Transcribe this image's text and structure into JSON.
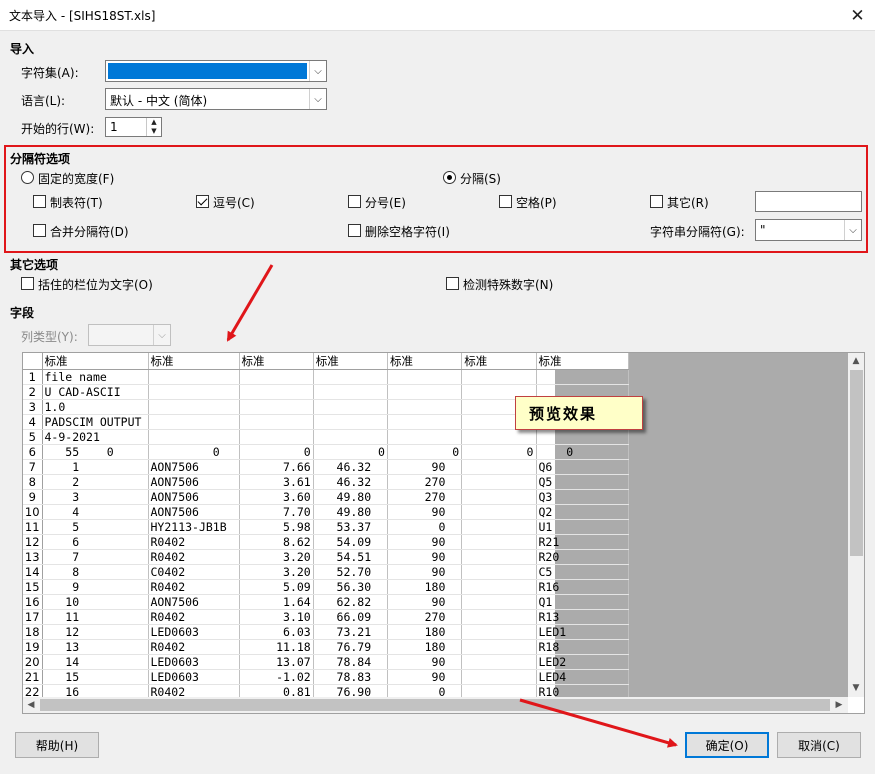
{
  "window": {
    "title": "文本导入 - [SIHS18ST.xls]",
    "close_glyph": "✕"
  },
  "import": {
    "section_label": "导入",
    "charset": {
      "label": "字符集(A):",
      "value": ""
    },
    "language": {
      "label": "语言(L):",
      "value": "默认 - 中文 (简体)"
    },
    "start_row": {
      "label": "开始的行(W):",
      "value": "1"
    }
  },
  "delimiter": {
    "section_label": "分隔符选项",
    "fixed_width": {
      "label": "固定的宽度(F)",
      "checked": false
    },
    "delimited": {
      "label": "分隔(S)",
      "checked": true
    },
    "tab": {
      "label": "制表符(T)",
      "checked": false
    },
    "comma": {
      "label": "逗号(C)",
      "checked": true
    },
    "semicolon": {
      "label": "分号(E)",
      "checked": false
    },
    "space": {
      "label": "空格(P)",
      "checked": false
    },
    "other": {
      "label": "其它(R)",
      "checked": false,
      "value": ""
    },
    "merge": {
      "label": "合并分隔符(D)",
      "checked": false
    },
    "trim_spaces": {
      "label": "删除空格字符(I)",
      "checked": false
    },
    "string_delim": {
      "label": "字符串分隔符(G):",
      "value": "\""
    }
  },
  "other_options": {
    "section_label": "其它选项",
    "quoted_text": {
      "label": "括住的栏位为文字(O)",
      "checked": false
    },
    "detect_numbers": {
      "label": "检测特殊数字(N)",
      "checked": false
    }
  },
  "fields": {
    "section_label": "字段",
    "column_type": {
      "label": "列类型(Y):",
      "value": ""
    }
  },
  "grid": {
    "headers": [
      "标准",
      "标准",
      "标准",
      "标准",
      "标准",
      "标准",
      "标准"
    ],
    "rows": [
      [
        "1",
        "file name",
        "",
        "",
        "",
        "",
        "",
        ""
      ],
      [
        "2",
        "U CAD-ASCII",
        "",
        "",
        "",
        "",
        "",
        ""
      ],
      [
        "3",
        "1.0",
        "",
        "",
        "",
        "",
        "",
        ""
      ],
      [
        "4",
        "PADSCIM OUTPUT",
        "",
        "",
        "",
        "",
        "",
        ""
      ],
      [
        "5",
        "4-9-2021",
        "",
        "",
        "",
        "",
        "",
        ""
      ],
      [
        "6",
        "   55    0",
        "         0",
        "         0",
        "         0",
        "         0",
        "         0",
        "    0"
      ],
      [
        "7",
        "    1",
        "AON7506",
        "      7.66",
        "   46.32",
        "      90",
        "",
        "Q6"
      ],
      [
        "8",
        "    2",
        "AON7506",
        "      3.61",
        "   46.32",
        "     270",
        "",
        "Q5"
      ],
      [
        "9",
        "    3",
        "AON7506",
        "      3.60",
        "   49.80",
        "     270",
        "",
        "Q3"
      ],
      [
        "10",
        "    4",
        "AON7506",
        "      7.70",
        "   49.80",
        "      90",
        "",
        "Q2"
      ],
      [
        "11",
        "    5",
        "HY2113-JB1B",
        "      5.98",
        "   53.37",
        "       0",
        "",
        "U1"
      ],
      [
        "12",
        "    6",
        "R0402",
        "      8.62",
        "   54.09",
        "      90",
        "",
        "R21"
      ],
      [
        "13",
        "    7",
        "R0402",
        "      3.20",
        "   54.51",
        "      90",
        "",
        "R20"
      ],
      [
        "14",
        "    8",
        "C0402",
        "      3.20",
        "   52.70",
        "      90",
        "",
        "C5"
      ],
      [
        "15",
        "    9",
        "R0402",
        "      5.09",
        "   56.30",
        "     180",
        "",
        "R16"
      ],
      [
        "16",
        "   10",
        "AON7506",
        "      1.64",
        "   62.82",
        "      90",
        "",
        "Q1"
      ],
      [
        "17",
        "   11",
        "R0402",
        "      3.10",
        "   66.09",
        "     270",
        "",
        "R13"
      ],
      [
        "18",
        "   12",
        "LED0603",
        "      6.03",
        "   73.21",
        "     180",
        "",
        "LED1"
      ],
      [
        "19",
        "   13",
        "R0402",
        "     11.18",
        "   76.79",
        "     180",
        "",
        "R18"
      ],
      [
        "20",
        "   14",
        "LED0603",
        "     13.07",
        "   78.84",
        "      90",
        "",
        "LED2"
      ],
      [
        "21",
        "   15",
        "LED0603",
        "     -1.02",
        "   78.83",
        "      90",
        "",
        "LED4"
      ],
      [
        "22",
        "   16",
        "R0402",
        "      0.81",
        "   76.90",
        "       0",
        "",
        "R10"
      ]
    ]
  },
  "callout": {
    "text": "预览效果"
  },
  "buttons": {
    "help": "帮助(H)",
    "ok": "确定(O)",
    "cancel": "取消(C)"
  },
  "colors": {
    "annotation_red": "#e0161a",
    "selection_blue": "#0078d7",
    "callout_bg": "#ffffc8"
  },
  "icons": {
    "caret": "chevron-down-icon",
    "spin_up": "▲",
    "spin_down": "▼"
  }
}
